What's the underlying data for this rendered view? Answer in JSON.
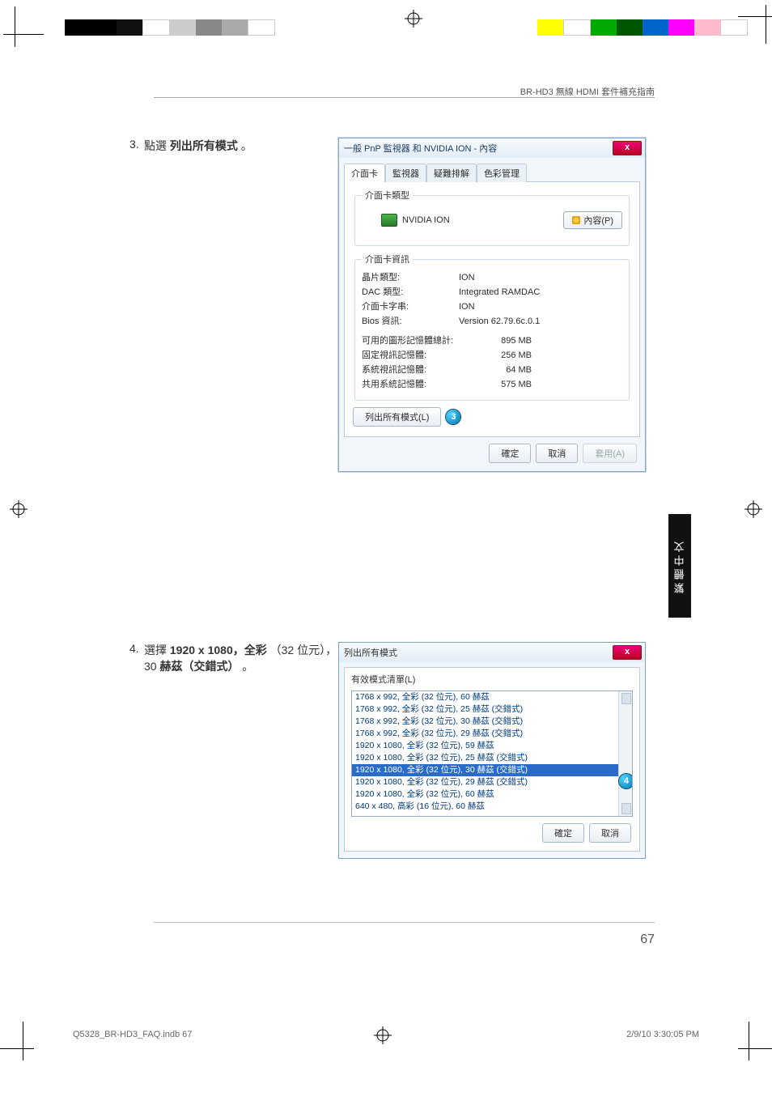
{
  "header": {
    "doc_title": "BR-HD3 無線 HDMI 套件補充指南"
  },
  "side_tab": "繁體中文",
  "page_number": "67",
  "print_footer": {
    "left": "Q5328_BR-HD3_FAQ.indb   67",
    "right": "2/9/10   3:30:05 PM"
  },
  "step3": {
    "num": "3.",
    "prefix": "點選 ",
    "bold": "列出所有模式",
    "suffix": "。"
  },
  "step4": {
    "num": "4.",
    "prefix": "選擇 ",
    "bold1": "1920 x 1080，全彩",
    "mid": "（32 位元），30 ",
    "bold2": "赫茲（交錯式）",
    "suffix": "。"
  },
  "dialog1": {
    "title_prefix": "一般 PnP 監視器 和 NVIDIA ION",
    "title_suffix": "  - 內容",
    "close": "x",
    "tabs": {
      "t1": "介面卡",
      "t2": "監視器",
      "t3": "疑難排解",
      "t4": "色彩管理"
    },
    "group_adapter_type": "介面卡類型",
    "adapter_name": "NVIDIA ION",
    "btn_properties": "內容(P)",
    "group_adapter_info": "介面卡資訊",
    "info": [
      {
        "k": "晶片類型:",
        "v": "ION"
      },
      {
        "k": "DAC 類型:",
        "v": "Integrated RAMDAC"
      },
      {
        "k": "介面卡字串:",
        "v": "ION"
      },
      {
        "k": "Bios 資訊:",
        "v": "Version 62.79.6c.0.1"
      }
    ],
    "mem": [
      {
        "k": "可用的圖形記憶體總計:",
        "v": "895 MB"
      },
      {
        "k": "固定視訊記憶體:",
        "v": "256 MB"
      },
      {
        "k": "系統視訊記憶體:",
        "v": "64 MB"
      },
      {
        "k": "共用系統記憶體:",
        "v": "575 MB"
      }
    ],
    "btn_list_all": "列出所有模式(L)",
    "callout3": "3",
    "btn_ok": "確定",
    "btn_cancel": "取消",
    "btn_apply": "套用(A)"
  },
  "dialog2": {
    "title": "列出所有模式",
    "close": "x",
    "list_label": "有效模式清單(L)",
    "items": [
      "1768 x 992, 全彩 (32 位元), 60 赫茲",
      "1768 x 992, 全彩 (32 位元), 25 赫茲 (交錯式)",
      "1768 x 992, 全彩 (32 位元), 30 赫茲 (交錯式)",
      "1768 x 992, 全彩 (32 位元), 29 赫茲 (交錯式)",
      "1920 x 1080, 全彩 (32 位元), 59 赫茲",
      "1920 x 1080, 全彩 (32 位元), 25 赫茲 (交錯式)",
      "1920 x 1080, 全彩 (32 位元), 30 赫茲 (交錯式)",
      "1920 x 1080, 全彩 (32 位元), 29 赫茲 (交錯式)",
      "1920 x 1080, 全彩 (32 位元), 60 赫茲",
      "640 x 480, 高彩 (16 位元), 60 赫茲"
    ],
    "selected_index": 6,
    "callout4": "4",
    "btn_ok": "確定",
    "btn_cancel": "取消"
  }
}
